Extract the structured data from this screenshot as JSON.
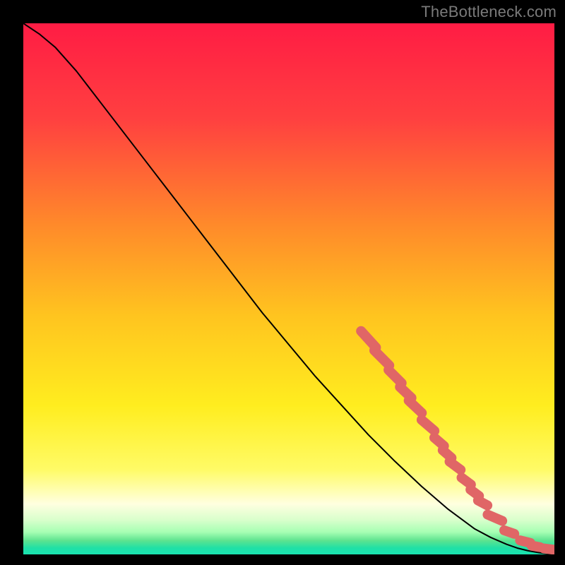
{
  "watermark": "TheBottleneck.com",
  "colors": {
    "line": "#000000",
    "dot": "#e06666",
    "frame_bg": "#000000"
  },
  "gradient_stops": [
    {
      "offset": 0.0,
      "color": "#ff1c44"
    },
    {
      "offset": 0.18,
      "color": "#ff4040"
    },
    {
      "offset": 0.38,
      "color": "#ff8a2a"
    },
    {
      "offset": 0.55,
      "color": "#ffc41f"
    },
    {
      "offset": 0.72,
      "color": "#ffed1f"
    },
    {
      "offset": 0.84,
      "color": "#fffb66"
    },
    {
      "offset": 0.905,
      "color": "#ffffe0"
    },
    {
      "offset": 0.935,
      "color": "#d9ffcc"
    },
    {
      "offset": 0.958,
      "color": "#a6ffb3"
    },
    {
      "offset": 0.974,
      "color": "#5de38f"
    },
    {
      "offset": 0.988,
      "color": "#20e0a6"
    },
    {
      "offset": 1.0,
      "color": "#19e3b0"
    }
  ],
  "chart_data": {
    "type": "line",
    "title": "",
    "xlabel": "",
    "ylabel": "",
    "xlim": [
      0,
      100
    ],
    "ylim": [
      0,
      100
    ],
    "series": [
      {
        "name": "curve",
        "x": [
          0,
          3,
          6,
          10,
          15,
          20,
          25,
          30,
          35,
          40,
          45,
          50,
          55,
          60,
          65,
          70,
          75,
          80,
          85,
          88,
          91,
          93,
          95,
          97,
          99,
          100
        ],
        "y": [
          100,
          98,
          95.5,
          91,
          84.5,
          78,
          71.5,
          65,
          58.5,
          52,
          45.5,
          39.5,
          33.5,
          28,
          22.5,
          17.5,
          12.8,
          8.5,
          4.8,
          3.2,
          1.9,
          1.2,
          0.7,
          0.35,
          0.1,
          0.05
        ]
      }
    ],
    "dots": [
      {
        "x": 65.0,
        "y": 40.5,
        "len": 4.2
      },
      {
        "x": 67.5,
        "y": 37.0,
        "len": 4.0
      },
      {
        "x": 70.0,
        "y": 33.5,
        "len": 3.5
      },
      {
        "x": 72.0,
        "y": 30.5,
        "len": 3.0
      },
      {
        "x": 73.8,
        "y": 27.8,
        "len": 3.4
      },
      {
        "x": 76.2,
        "y": 24.3,
        "len": 3.2
      },
      {
        "x": 78.3,
        "y": 21.2,
        "len": 2.4
      },
      {
        "x": 79.8,
        "y": 18.9,
        "len": 2.2
      },
      {
        "x": 81.3,
        "y": 16.7,
        "len": 2.6
      },
      {
        "x": 83.4,
        "y": 13.8,
        "len": 2.2
      },
      {
        "x": 85.0,
        "y": 11.6,
        "len": 2.0
      },
      {
        "x": 86.5,
        "y": 9.7,
        "len": 2.0
      },
      {
        "x": 88.8,
        "y": 6.9,
        "len": 3.0
      },
      {
        "x": 91.5,
        "y": 4.2,
        "len": 2.0
      },
      {
        "x": 94.5,
        "y": 2.4,
        "len": 2.0
      },
      {
        "x": 96.5,
        "y": 1.5,
        "len": 1.6
      },
      {
        "x": 99.0,
        "y": 1.0,
        "len": 2.0
      }
    ]
  }
}
